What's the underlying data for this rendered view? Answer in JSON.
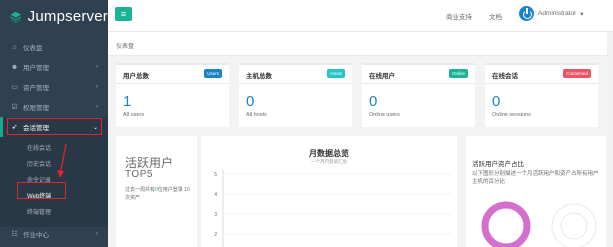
{
  "app": {
    "logo_text": "Jumpserver"
  },
  "sidebar": {
    "items": [
      {
        "icon": "dashboard-icon",
        "glyph": "⌂",
        "label": "仪表盘",
        "arrow": ""
      },
      {
        "icon": "users-icon",
        "glyph": "☻",
        "label": "用户管理",
        "arrow": "›"
      },
      {
        "icon": "assets-icon",
        "glyph": "▭",
        "label": "资产管理",
        "arrow": "›"
      },
      {
        "icon": "perms-icon",
        "glyph": "☑",
        "label": "权限管理",
        "arrow": "›"
      },
      {
        "icon": "session-icon",
        "glyph": "➶",
        "label": "会话管理",
        "arrow": "⌄"
      }
    ],
    "submenu": [
      "在线会话",
      "历史会话",
      "命令记录",
      "Web终端",
      "终端管理"
    ],
    "bottom": {
      "icon": "jobs-icon",
      "glyph": "☷",
      "label": "作业中心",
      "arrow": "›"
    }
  },
  "topbar": {
    "menu_glyph": "≡",
    "support": "商业支持",
    "docs": "文档",
    "user": "Administrator",
    "caret": "▾"
  },
  "breadcrumb": "仪表盘",
  "cards": [
    {
      "title": "用户总数",
      "badge": "Users",
      "badge_color": "#1c84c6",
      "value": "1",
      "sub": "All users"
    },
    {
      "title": "主机总数",
      "badge": "Hosts",
      "badge_color": "#23c6c8",
      "value": "0",
      "sub": "All hosts"
    },
    {
      "title": "在线用户",
      "badge": "Online",
      "badge_color": "#1ab394",
      "value": "0",
      "sub": "Online users"
    },
    {
      "title": "在线会话",
      "badge": "Connected",
      "badge_color": "#ed5565",
      "value": "0",
      "sub": "Online sessions"
    }
  ],
  "active_panel": {
    "title": "活跃用户",
    "subtitle": "TOP5",
    "desc_before": "过去一周共有",
    "desc_highlight": "0",
    "desc_after": "位用户登录 10次资产."
  },
  "month_panel": {
    "title": "月数据总览",
    "subtitle": "一个月内登录汇总"
  },
  "chart_data": {
    "type": "line",
    "title": "月数据总览",
    "y_ticks": [
      5,
      4,
      3,
      2
    ],
    "series": []
  },
  "pie_panel": {
    "title": "活跃用户资产占比",
    "desc": "以下图形分别描述一个月活跃用户和资产占所有用户主机的百分比"
  },
  "colors": {
    "accent": "#1ab394",
    "sidebar": "#2f4050",
    "highlight": "#e0262b",
    "ring": "#d46fd0"
  }
}
